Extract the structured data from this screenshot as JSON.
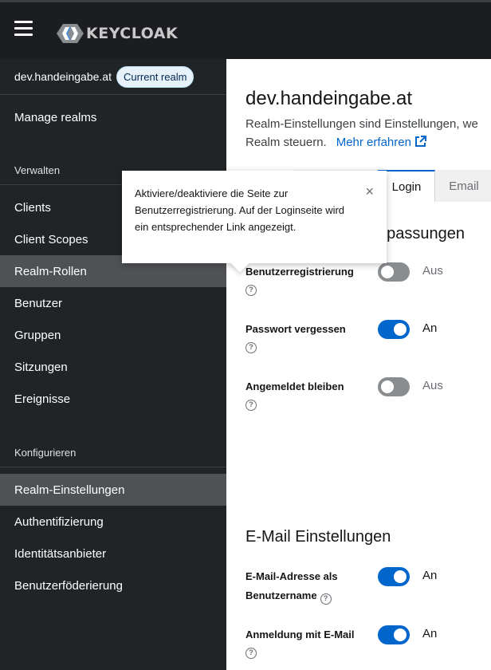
{
  "masthead": {
    "logo_text": "KEYCLOAK"
  },
  "sidebar": {
    "realm_name": "dev.handeingabe.at",
    "realm_badge": "Current realm",
    "manage_realms": "Manage realms",
    "section_manage": "Verwalten",
    "manage_items": [
      "Clients",
      "Client Scopes",
      "Realm-Rollen",
      "Benutzer",
      "Gruppen",
      "Sitzungen",
      "Ereignisse"
    ],
    "section_configure": "Konfigurieren",
    "configure_items": [
      "Realm-Einstellungen",
      "Authentifizierung",
      "Identitätsanbieter",
      "Benutzerföderierung"
    ]
  },
  "main": {
    "title": "dev.handeingabe.at",
    "description_line1": "Realm-Einstellungen sind Einstellungen, we",
    "description_line2": "Realm steuern.",
    "more_link": "Mehr erfahren",
    "tabs": [
      "Login",
      "Email"
    ],
    "section_login_partial": "npassungen",
    "login_rows": [
      {
        "label": "Benutzerregistrierung",
        "state": "Aus",
        "on": false
      },
      {
        "label": "Passwort vergessen",
        "state": "An",
        "on": true
      },
      {
        "label": "Angemeldet bleiben",
        "state": "Aus",
        "on": false
      }
    ],
    "section_email": "E-Mail Einstellungen",
    "email_rows": [
      {
        "label": "E-Mail-Adresse als Benutzername",
        "state": "An",
        "on": true
      },
      {
        "label": "Anmeldung mit E-Mail",
        "state": "An",
        "on": true
      }
    ],
    "help_glyph": "?"
  },
  "tooltip": {
    "text": "Aktiviere/deaktiviere die Seite zur Benutzerregistrierung. Auf der Loginseite wird ein entsprechender Link angezeigt.",
    "close_glyph": "×"
  },
  "colors": {
    "accent": "#0066cc",
    "sidebar_bg": "#212427",
    "masthead_bg": "#1b1d21",
    "active_nav": "#4f5255"
  }
}
